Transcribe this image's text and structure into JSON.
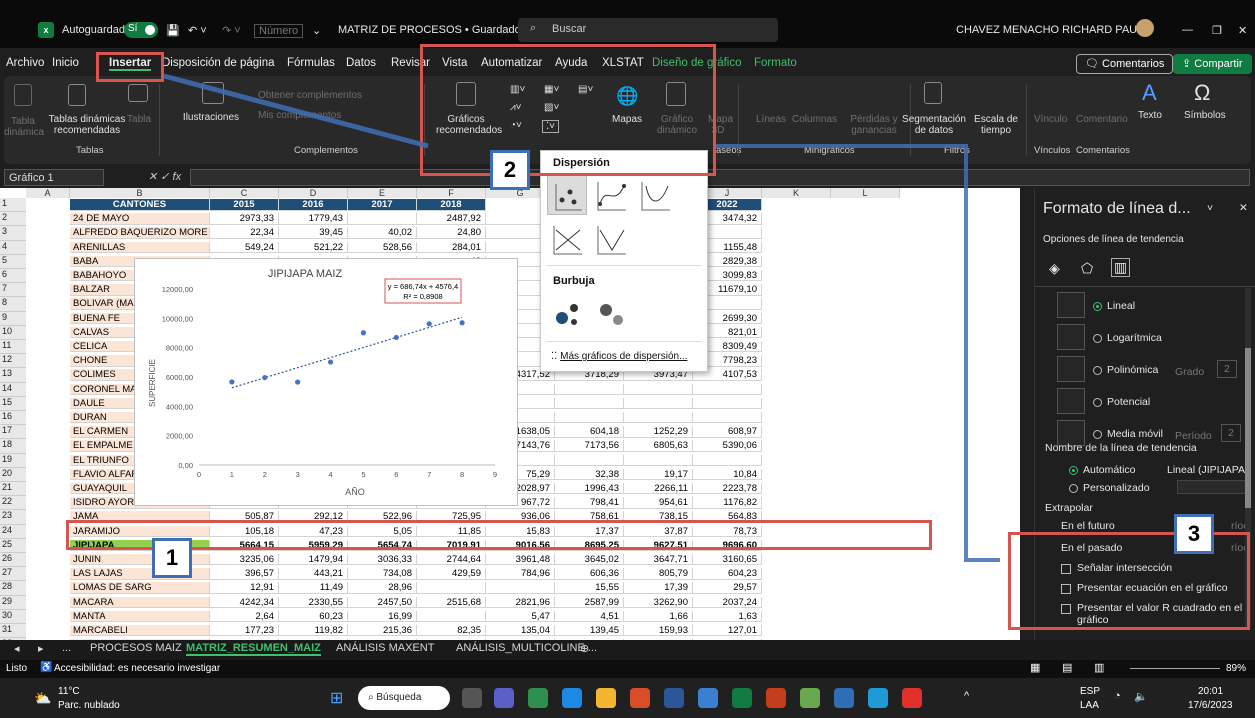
{
  "title_bar": {
    "autosave_label": "Autoguardado",
    "autosave_state": "Sí",
    "number_format": "Número",
    "doc_title": "MATRIZ DE PROCESOS • Guardado",
    "search_placeholder": "Buscar",
    "user_name": "CHAVEZ MENACHO RICHARD PAUL"
  },
  "menu": [
    "Archivo",
    "Inicio",
    "Insertar",
    "Disposición de página",
    "Fórmulas",
    "Datos",
    "Revisar",
    "Vista",
    "Automatizar",
    "Ayuda",
    "XLSTAT",
    "Diseño de gráfico",
    "Formato"
  ],
  "comments_label": "Comentarios",
  "share_label": "Compartir",
  "ribbon": {
    "tabla_dinamica": "Tabla dinámica",
    "tablas_recomendadas": "Tablas dinámicas recomendadas",
    "tabla": "Tabla",
    "ilustraciones": "Ilustraciones",
    "obtener_complementos": "Obtener complementos",
    "mis_complementos": "Mis complementos",
    "graficos_recomendados": "Gráficos recomendados",
    "mapas": "Mapas",
    "grafico_dinamico": "Gráfico dinámico",
    "mapa_3d": "Mapa 3D",
    "lineas": "Líneas",
    "columnas": "Columnas",
    "perdidas": "Pérdidas y ganancias",
    "segmentacion": "Segmentación de datos",
    "escala_tiempo": "Escala de tiempo",
    "vinculo": "Vínculo",
    "comentario": "Comentario",
    "texto": "Texto",
    "simbolos": "Símbolos",
    "groups": {
      "tablas": "Tablas",
      "complementos": "Complementos",
      "paseos": "aseos",
      "minigraficos": "Minigráficos",
      "filtros": "Filtros",
      "vinculos": "Vínculos",
      "comentarios": "Comentarios"
    }
  },
  "name_box": "Gráfico 1",
  "columns": [
    "A",
    "B",
    "C",
    "D",
    "E",
    "F",
    "G",
    "H",
    "I",
    "J",
    "K",
    "L"
  ],
  "table_header": {
    "b": "CANTONES",
    "c": "2015",
    "d": "2016",
    "e": "2017",
    "f": "2018",
    "i": "2021",
    "j": "2022"
  },
  "rows": [
    {
      "n": "2",
      "b": "24 DE MAYO",
      "c": "2973,33",
      "d": "1779,43",
      "e": "",
      "f": "2487,92",
      "g": "",
      "h": "",
      "i": "3641,00",
      "j": "3474,32"
    },
    {
      "n": "3",
      "b": "ALFREDO BAQUERIZO MORE",
      "c": "22,34",
      "d": "39,45",
      "e": "40,02",
      "f": "24,80",
      "g": "",
      "h": "",
      "i": "",
      "j": ""
    },
    {
      "n": "4",
      "b": "ARENILLAS",
      "c": "549,24",
      "d": "521,22",
      "e": "528,56",
      "f": "284,01",
      "g": "",
      "h": "",
      "i": "992,89",
      "j": "1155,48"
    },
    {
      "n": "5",
      "b": "BABA",
      "c": "",
      "d": "",
      "e": "",
      "f": "43",
      "g": "",
      "h": "",
      "i": "2930,76",
      "j": "2829,38"
    },
    {
      "n": "6",
      "b": "BABAHOYO",
      "c": "",
      "d": "",
      "e": "",
      "f": "15",
      "g": "",
      "h": "",
      "i": "3384,26",
      "j": "3099,83"
    },
    {
      "n": "7",
      "b": "BALZAR",
      "c": "",
      "d": "",
      "e": "",
      "f": "0",
      "g": "",
      "h": "",
      "i": "12692,37",
      "j": "11679,10"
    },
    {
      "n": "8",
      "b": "BOLIVAR (MAI",
      "c": "",
      "d": "",
      "e": "",
      "f": "76",
      "g": "",
      "h": "",
      "i": "2149,71",
      "j": ""
    },
    {
      "n": "9",
      "b": "BUENA FE",
      "c": "",
      "d": "",
      "e": "",
      "f": "53",
      "g": "",
      "h": "",
      "i": "2431,77",
      "j": "2699,30"
    },
    {
      "n": "10",
      "b": "CALVAS",
      "c": "",
      "d": "",
      "e": "",
      "f": "71",
      "g": "",
      "h": "",
      "i": "1608,85",
      "j": "821,01"
    },
    {
      "n": "11",
      "b": "CELICA",
      "c": "",
      "d": "",
      "e": "",
      "f": "10",
      "g": "",
      "h": "",
      "i": "8693,98",
      "j": "8309,49"
    },
    {
      "n": "12",
      "b": "CHONE",
      "c": "",
      "d": "",
      "e": "",
      "f": "99",
      "g": "",
      "h": "",
      "i": "8705,91",
      "j": "7798,23"
    },
    {
      "n": "13",
      "b": "COLIMES",
      "c": "",
      "d": "",
      "e": "",
      "f": "85",
      "g": "4317,52",
      "h": "3718,29",
      "i": "3973,47",
      "j": "4107,53"
    },
    {
      "n": "14",
      "b": "CORONEL MA",
      "c": "",
      "d": "",
      "e": "",
      "f": "",
      "g": "",
      "h": "",
      "i": "",
      "j": ""
    },
    {
      "n": "15",
      "b": "DAULE",
      "c": "",
      "d": "",
      "e": "",
      "f": "",
      "g": "",
      "h": "",
      "i": "",
      "j": ""
    },
    {
      "n": "16",
      "b": "DURAN",
      "c": "",
      "d": "",
      "e": "",
      "f": "",
      "g": "",
      "h": "",
      "i": "",
      "j": ""
    },
    {
      "n": "17",
      "b": "EL CARMEN",
      "c": "",
      "d": "",
      "e": "",
      "f": "95",
      "g": "1638,05",
      "h": "604,18",
      "i": "1252,29",
      "j": "608,97"
    },
    {
      "n": "18",
      "b": "EL EMPALME",
      "c": "",
      "d": "",
      "e": "",
      "f": "91",
      "g": "7143,76",
      "h": "7173,56",
      "i": "6805,63",
      "j": "5390,06"
    },
    {
      "n": "19",
      "b": "EL TRIUNFO",
      "c": "",
      "d": "",
      "e": "",
      "f": "",
      "g": "",
      "h": "",
      "i": "",
      "j": ""
    },
    {
      "n": "20",
      "b": "FLAVIO ALFAR",
      "c": "",
      "d": "",
      "e": "",
      "f": "7",
      "g": "75,29",
      "h": "32,38",
      "i": "19,17",
      "j": "10,84"
    },
    {
      "n": "21",
      "b": "GUAYAQUIL",
      "c": "",
      "d": "",
      "e": "",
      "f": "04",
      "g": "2028,97",
      "h": "1996,43",
      "i": "2266,11",
      "j": "2223,78"
    },
    {
      "n": "22",
      "b": "ISIDRO AYORA",
      "c": "",
      "d": "",
      "e": "",
      "f": "14",
      "g": "967,72",
      "h": "798,41",
      "i": "954,61",
      "j": "1176,82"
    },
    {
      "n": "23",
      "b": "JAMA",
      "c": "505,87",
      "d": "292,12",
      "e": "522,96",
      "f": "725,95",
      "g": "936,06",
      "h": "758,61",
      "i": "738,15",
      "j": "564,83"
    },
    {
      "n": "24",
      "b": "JARAMIJO",
      "c": "105,18",
      "d": "47,23",
      "e": "5,05",
      "f": "11,85",
      "g": "15,83",
      "h": "17,37",
      "i": "37,87",
      "j": "78,73"
    },
    {
      "n": "25",
      "b": "JIPIJAPA",
      "c": "5664,15",
      "d": "5959,29",
      "e": "5654,74",
      "f": "7019,91",
      "g": "9016,56",
      "h": "8695,25",
      "i": "9627,51",
      "j": "9696,60"
    },
    {
      "n": "26",
      "b": "JUNIN",
      "c": "3235,06",
      "d": "1479,94",
      "e": "3036,33",
      "f": "2744,64",
      "g": "3961,48",
      "h": "3645,02",
      "i": "3647,71",
      "j": "3160,65"
    },
    {
      "n": "27",
      "b": "LAS LAJAS",
      "c": "396,57",
      "d": "443,21",
      "e": "734,08",
      "f": "429,59",
      "g": "784,96",
      "h": "606,36",
      "i": "805,79",
      "j": "604,23"
    },
    {
      "n": "28",
      "b": "LOMAS DE SARG",
      "c": "12,91",
      "d": "11,49",
      "e": "28,96",
      "f": "",
      "g": "",
      "h": "15,55",
      "i": "17,39",
      "j": "29,57"
    },
    {
      "n": "29",
      "b": "MACARA",
      "c": "4242,34",
      "d": "2330,55",
      "e": "2457,50",
      "f": "2515,68",
      "g": "2821,96",
      "h": "2587,99",
      "i": "3262,90",
      "j": "2037,24"
    },
    {
      "n": "30",
      "b": "MANTA",
      "c": "2,64",
      "d": "60,23",
      "e": "16,99",
      "f": "",
      "g": "5,47",
      "h": "4,51",
      "i": "1,66",
      "j": "1,63"
    },
    {
      "n": "31",
      "b": "MARCABELI",
      "c": "177,23",
      "d": "119,82",
      "e": "215,36",
      "f": "82,35",
      "g": "135,04",
      "h": "139,45",
      "i": "159,93",
      "j": "127,01"
    },
    {
      "n": "32",
      "b": "MILAGRO",
      "c": "660,04",
      "d": "238,72",
      "e": "108,31",
      "f": "31,73",
      "g": "",
      "h": "",
      "i": "",
      "j": ""
    }
  ],
  "chart_data": {
    "type": "scatter",
    "title": "JIPIJAPA MAIZ",
    "xlabel": "AÑO",
    "ylabel": "SUPERFICIE",
    "equation": "y = 686,74x + 4576,4",
    "r2": "R² = 0,8908",
    "x": [
      1,
      2,
      3,
      4,
      5,
      6,
      7,
      8
    ],
    "y": [
      5664.15,
      5959.29,
      5654.74,
      7019.91,
      9016.56,
      8695.25,
      9627.51,
      9696.6
    ],
    "xlim": [
      0,
      9
    ],
    "ylim": [
      0,
      12000
    ],
    "xticks": [
      "0",
      "1",
      "2",
      "3",
      "4",
      "5",
      "6",
      "7",
      "8",
      "9"
    ],
    "yticks": [
      "0,00",
      "2000,00",
      "4000,00",
      "6000,00",
      "8000,00",
      "10000,00",
      "12000,00"
    ],
    "trendline": {
      "slope": 686.74,
      "intercept": 4576.4
    }
  },
  "gallery": {
    "dispersion": "Dispersión",
    "burbuja": "Burbuja",
    "mas": "Más gráficos de dispersión..."
  },
  "panel": {
    "title": "Formato de línea d...",
    "subtitle": "Opciones de línea de tendencia",
    "lineal": "Lineal",
    "logaritmica": "Logarítmica",
    "polinomica": "Polinómica",
    "grado": "Grado",
    "grado_val": "2",
    "potencial": "Potencial",
    "media_movil": "Media móvil",
    "periodo": "Período",
    "periodo_val": "2",
    "nombre": "Nombre de la línea de tendencia",
    "automatico": "Automático",
    "auto_val": "Lineal (JIPIJAPA",
    "personalizado": "Personalizado",
    "extrapolar": "Extrapolar",
    "futuro": "En el futuro",
    "pasado": "En el pasado",
    "periodos": "ríoc",
    "intersect": "Señalar intersección",
    "ecuacion": "Presentar ecuación en el gráfico",
    "r2": "Presentar el valor R cuadrado en el gráfico"
  },
  "sheet_tabs": [
    "...",
    "PROCESOS MAIZ",
    "MATRIZ_RESUMEN_MAIZ",
    "ANÁLISIS MAXENT",
    "ANÁLISIS_MULTICOLINE ..."
  ],
  "status": {
    "ready": "Listo",
    "accessibility": "Accesibilidad: es necesario investigar",
    "zoom": "89%"
  },
  "taskbar": {
    "temp": "11°C",
    "weather": "Parc. nublado",
    "search": "Búsqueda",
    "lang": "ESP",
    "lang2": "LAA",
    "time": "20:01",
    "date": "17/6/2023"
  },
  "badges": [
    "1",
    "2",
    "3"
  ],
  "colors": {
    "excel_green": "#107c41",
    "highlight_red": "#d9534f",
    "badge_blue": "#3f6fb5"
  }
}
